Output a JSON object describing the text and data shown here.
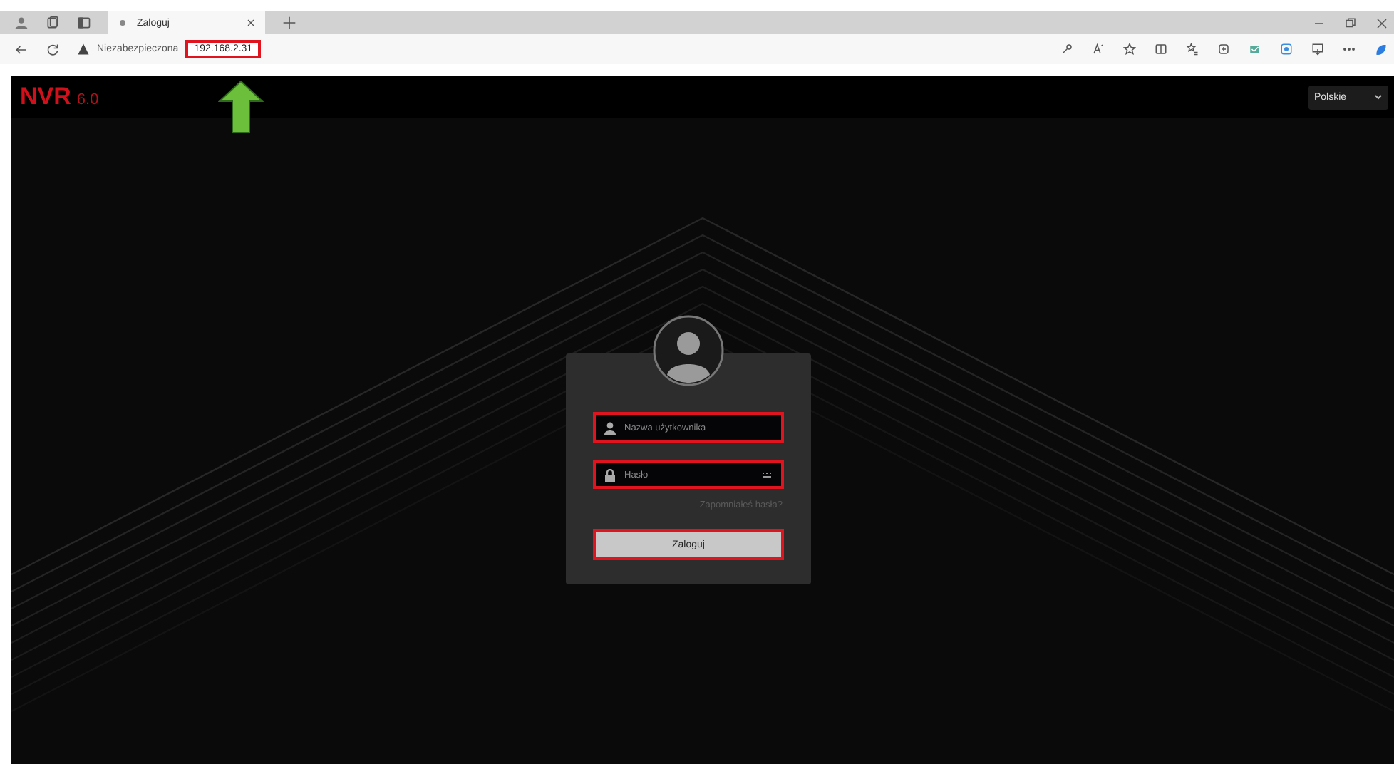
{
  "browser": {
    "tab": {
      "title": "Zaloguj"
    },
    "address_bar": {
      "security_label": "Niezabezpieczona",
      "url": "192.168.2.31",
      "highlighted": true
    }
  },
  "app": {
    "logo": {
      "name": "NVR",
      "version": "6.0"
    },
    "language": {
      "value": "Polskie"
    },
    "login": {
      "username": {
        "placeholder": "Nazwa użytkownika",
        "highlighted": true
      },
      "password": {
        "placeholder": "Hasło",
        "highlighted": true
      },
      "forgot_link": "Zapomniałeś hasła?",
      "submit": {
        "label": "Zaloguj",
        "highlighted": true
      }
    }
  }
}
